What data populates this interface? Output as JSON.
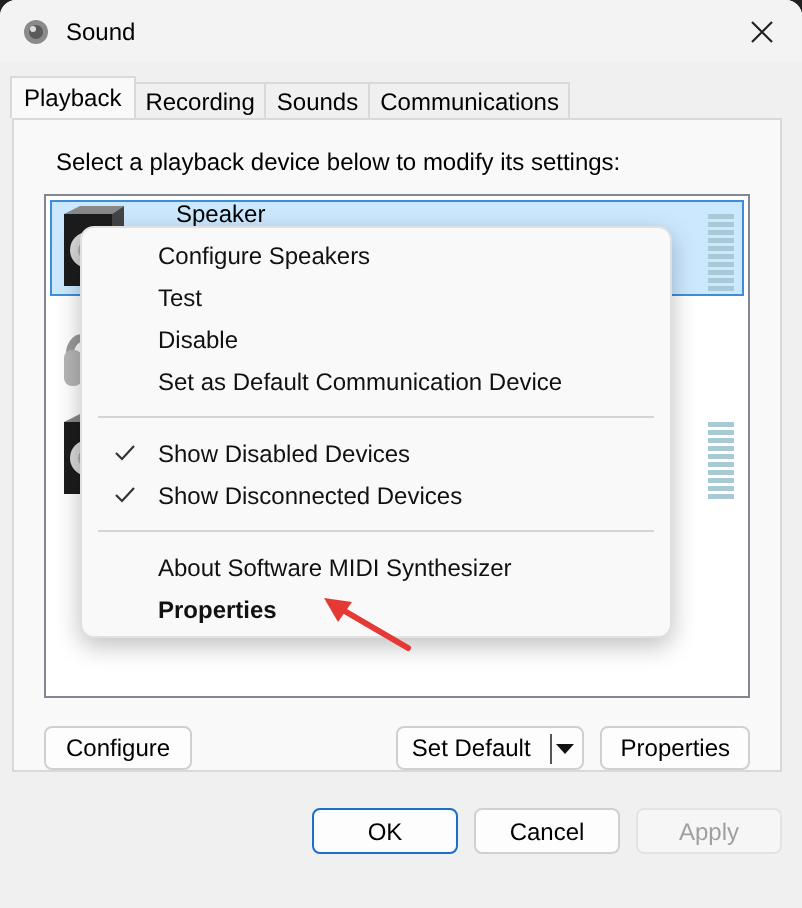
{
  "window": {
    "title": "Sound"
  },
  "tabs": [
    {
      "label": "Playback",
      "selected": true
    },
    {
      "label": "Recording",
      "selected": false
    },
    {
      "label": "Sounds",
      "selected": false
    },
    {
      "label": "Communications",
      "selected": false
    }
  ],
  "instruction": "Select a playback device below to modify its settings:",
  "devices": [
    {
      "name": "Speaker",
      "kind": "speaker",
      "selected": true,
      "meter": true
    },
    {
      "kind": "headphones",
      "selected": false,
      "meter": false
    },
    {
      "kind": "speaker",
      "selected": false,
      "meter": true
    }
  ],
  "context_menu": [
    {
      "kind": "item",
      "label": "Configure Speakers",
      "checked": false,
      "default": false
    },
    {
      "kind": "item",
      "label": "Test",
      "checked": false,
      "default": false
    },
    {
      "kind": "item",
      "label": "Disable",
      "checked": false,
      "default": false
    },
    {
      "kind": "item",
      "label": "Set as Default Communication Device",
      "checked": false,
      "default": false
    },
    {
      "kind": "separator"
    },
    {
      "kind": "item",
      "label": "Show Disabled Devices",
      "checked": true,
      "default": false
    },
    {
      "kind": "item",
      "label": "Show Disconnected Devices",
      "checked": true,
      "default": false
    },
    {
      "kind": "separator"
    },
    {
      "kind": "item",
      "label": "About Software MIDI Synthesizer",
      "checked": false,
      "default": false
    },
    {
      "kind": "item",
      "label": "Properties",
      "checked": false,
      "default": true
    }
  ],
  "panel_buttons": {
    "configure": "Configure",
    "set_default": "Set Default",
    "properties": "Properties"
  },
  "dialog_buttons": [
    {
      "label": "OK",
      "default": true,
      "disabled": false
    },
    {
      "label": "Cancel",
      "default": false,
      "disabled": false
    },
    {
      "label": "Apply",
      "default": false,
      "disabled": true
    }
  ]
}
